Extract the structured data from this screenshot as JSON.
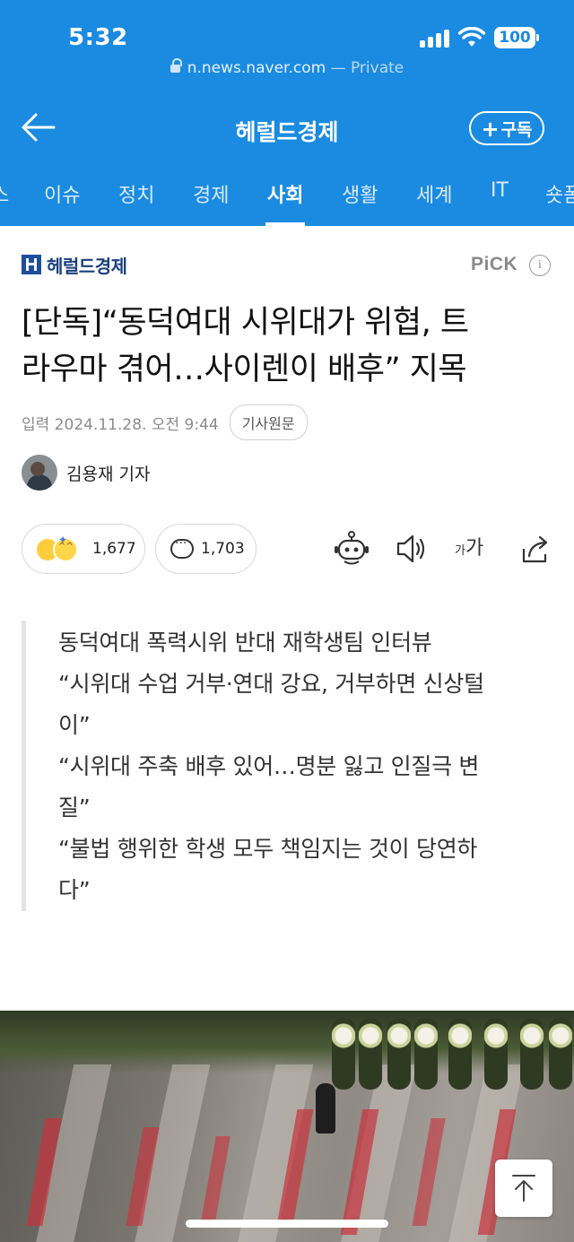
{
  "status_bar": {
    "time": "5:32",
    "battery": "100"
  },
  "browser": {
    "url": "n.news.naver.com",
    "privacy": "— Private"
  },
  "header": {
    "title": "헤럴드경제",
    "subscribe_label": "구독"
  },
  "tabs": [
    {
      "label": "스",
      "active": false
    },
    {
      "label": "이슈",
      "active": false
    },
    {
      "label": "정치",
      "active": false
    },
    {
      "label": "경제",
      "active": false
    },
    {
      "label": "사회",
      "active": true
    },
    {
      "label": "생활",
      "active": false
    },
    {
      "label": "세계",
      "active": false
    },
    {
      "label": "IT",
      "active": false
    },
    {
      "label": "숏폼",
      "active": false
    }
  ],
  "article": {
    "press": "헤럴드경제",
    "pick_label": "PiCK",
    "headline_line1": "[단독]“동덕여대 시위대가 위협, 트",
    "headline_line2": "라우마 겪어…사이렌이 배후” 지목",
    "date": "입력 2024.11.28. 오전 9:44",
    "original_button": "기사원문",
    "author": "김용재 기자",
    "reactions": "1,677",
    "comments": "1,703",
    "font_label_small": "가",
    "font_label_large": "가",
    "summary": [
      "동덕여대 폭력시위 반대 재학생팀 인터뷰",
      "“시위대 수업 거부·연대 강요, 거부하면 신상털",
      "이”",
      "“시위대 주축 배후 있어…명분 잃고 인질극 변",
      "질”",
      "“불법 행위한 학생 모두 책임지는 것이 당연하",
      "다”"
    ]
  },
  "colors": {
    "header_blue": "#1a8be0",
    "press_navy": "#1b3f7d"
  }
}
